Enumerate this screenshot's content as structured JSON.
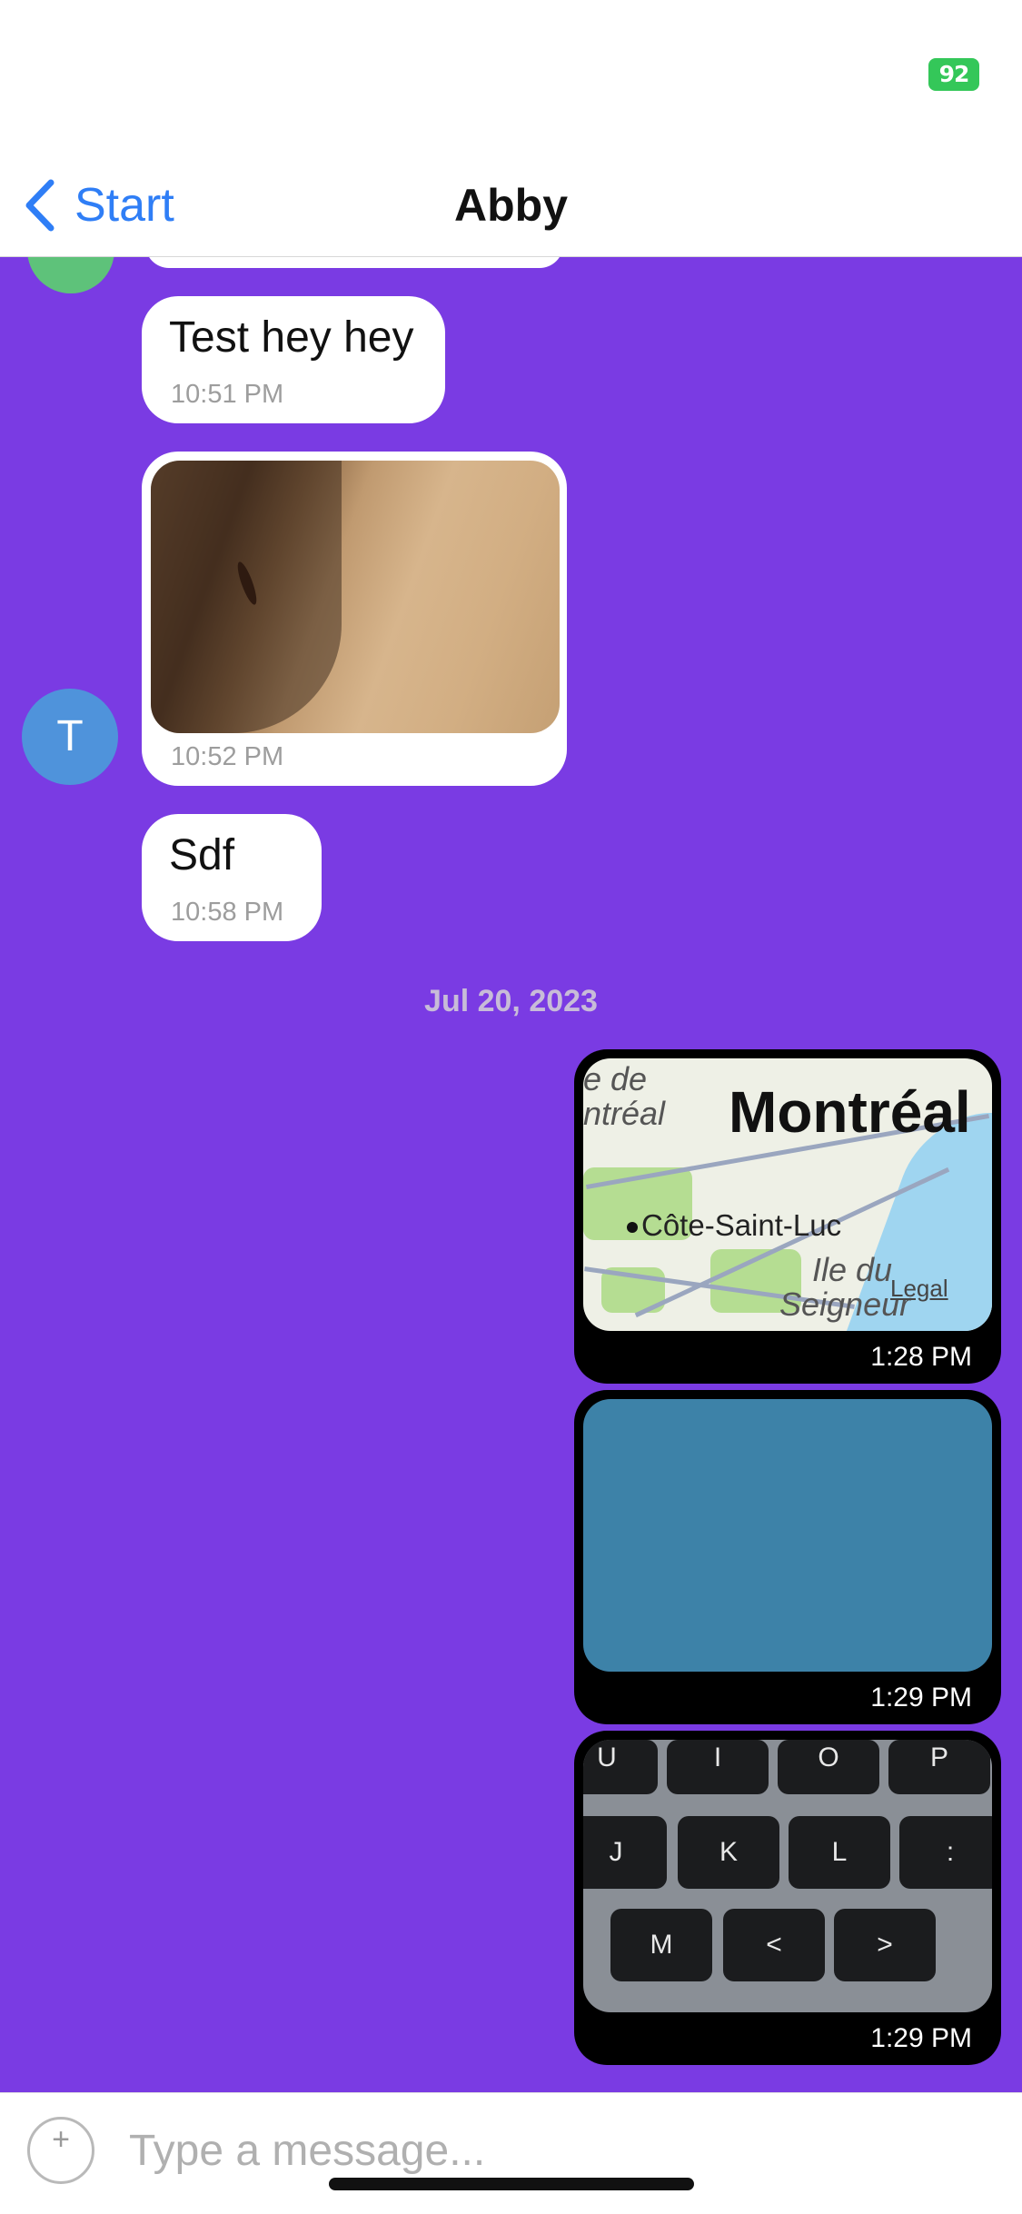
{
  "status_bar": {
    "battery": "92"
  },
  "nav": {
    "back_label": "Start",
    "title": "Abby"
  },
  "messages": [
    {
      "text": "Test hey hey",
      "time": "10:51 PM"
    },
    {
      "time": "10:52 PM"
    },
    {
      "text": "Sdf",
      "time": "10:58 PM"
    }
  ],
  "date_separator": "Jul 20, 2023",
  "avatar_initial": "T",
  "outgoing": [
    {
      "time": "1:28 PM"
    },
    {
      "time": "1:29 PM"
    },
    {
      "time": "1:29 PM"
    }
  ],
  "map": {
    "city_label": "Montréal",
    "partial_label_1": "e de",
    "partial_label_2": "ntréal",
    "place_label": "Côte-Saint-Luc",
    "island_label_1": "Ile du",
    "island_label_2": "Seigneur",
    "legal": "Legal"
  },
  "keyboard_keys": [
    "U",
    "I",
    "O",
    "P",
    "J",
    "K",
    "L",
    ":",
    "M",
    "<",
    ">"
  ],
  "input": {
    "placeholder": "Type a message..."
  },
  "colors": {
    "chat_background": "#7a3be3",
    "accent": "#2f7ef6",
    "outgoing_bubble": "#000000"
  }
}
